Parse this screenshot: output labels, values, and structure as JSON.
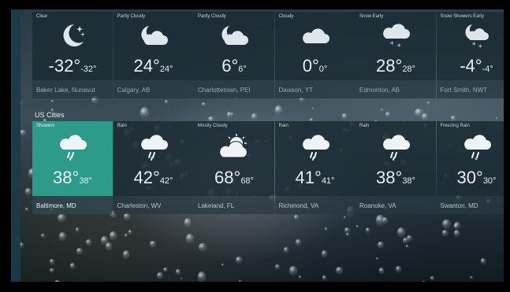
{
  "section_title": "US Cities",
  "canada": [
    {
      "condition": "Clear",
      "temp": "-32°",
      "feels": "-32°",
      "city": "Baker Lake, Nunavut",
      "icon": "moon-stars-icon"
    },
    {
      "condition": "Partly Cloudy",
      "temp": "24°",
      "feels": "24°",
      "city": "Calgary, AB",
      "icon": "cloud-moon-icon"
    },
    {
      "condition": "Partly Cloudy",
      "temp": "6°",
      "feels": "6°",
      "city": "Charlottetown, PEI",
      "icon": "cloud-moon-icon"
    },
    {
      "condition": "Cloudy",
      "temp": "0°",
      "feels": "0°",
      "city": "Dawson, YT",
      "icon": "cloud-icon"
    },
    {
      "condition": "Snow Early",
      "temp": "28°",
      "feels": "28°",
      "city": "Edmonton, AB",
      "icon": "cloud-snow-icon"
    },
    {
      "condition": "Snow Showers Early",
      "temp": "-4°",
      "feels": "-4°",
      "city": "Fort Smith, NWT",
      "icon": "moon-snow-icon"
    }
  ],
  "us": [
    {
      "condition": "Showers",
      "temp": "38°",
      "feels": "38°",
      "city": "Baltimore, MD",
      "icon": "cloud-rain-icon"
    },
    {
      "condition": "Rain",
      "temp": "42°",
      "feels": "42°",
      "city": "Charleston, WV",
      "icon": "cloud-rain-icon"
    },
    {
      "condition": "Mostly Cloudy",
      "temp": "68°",
      "feels": "68°",
      "city": "Lakeland, FL",
      "icon": "cloud-sun-icon"
    },
    {
      "condition": "Rain",
      "temp": "41°",
      "feels": "41°",
      "city": "Richmond, VA",
      "icon": "cloud-rain-icon"
    },
    {
      "condition": "Rain",
      "temp": "38°",
      "feels": "38°",
      "city": "Roanoke, VA",
      "icon": "cloud-rain-icon"
    },
    {
      "condition": "Freezing Rain",
      "temp": "30°",
      "feels": "30°",
      "city": "Swanton, MD",
      "icon": "cloud-freezing-rain-icon"
    }
  ],
  "colors": {
    "accent": "#2d9a8a",
    "tile": "#1c2c36"
  }
}
